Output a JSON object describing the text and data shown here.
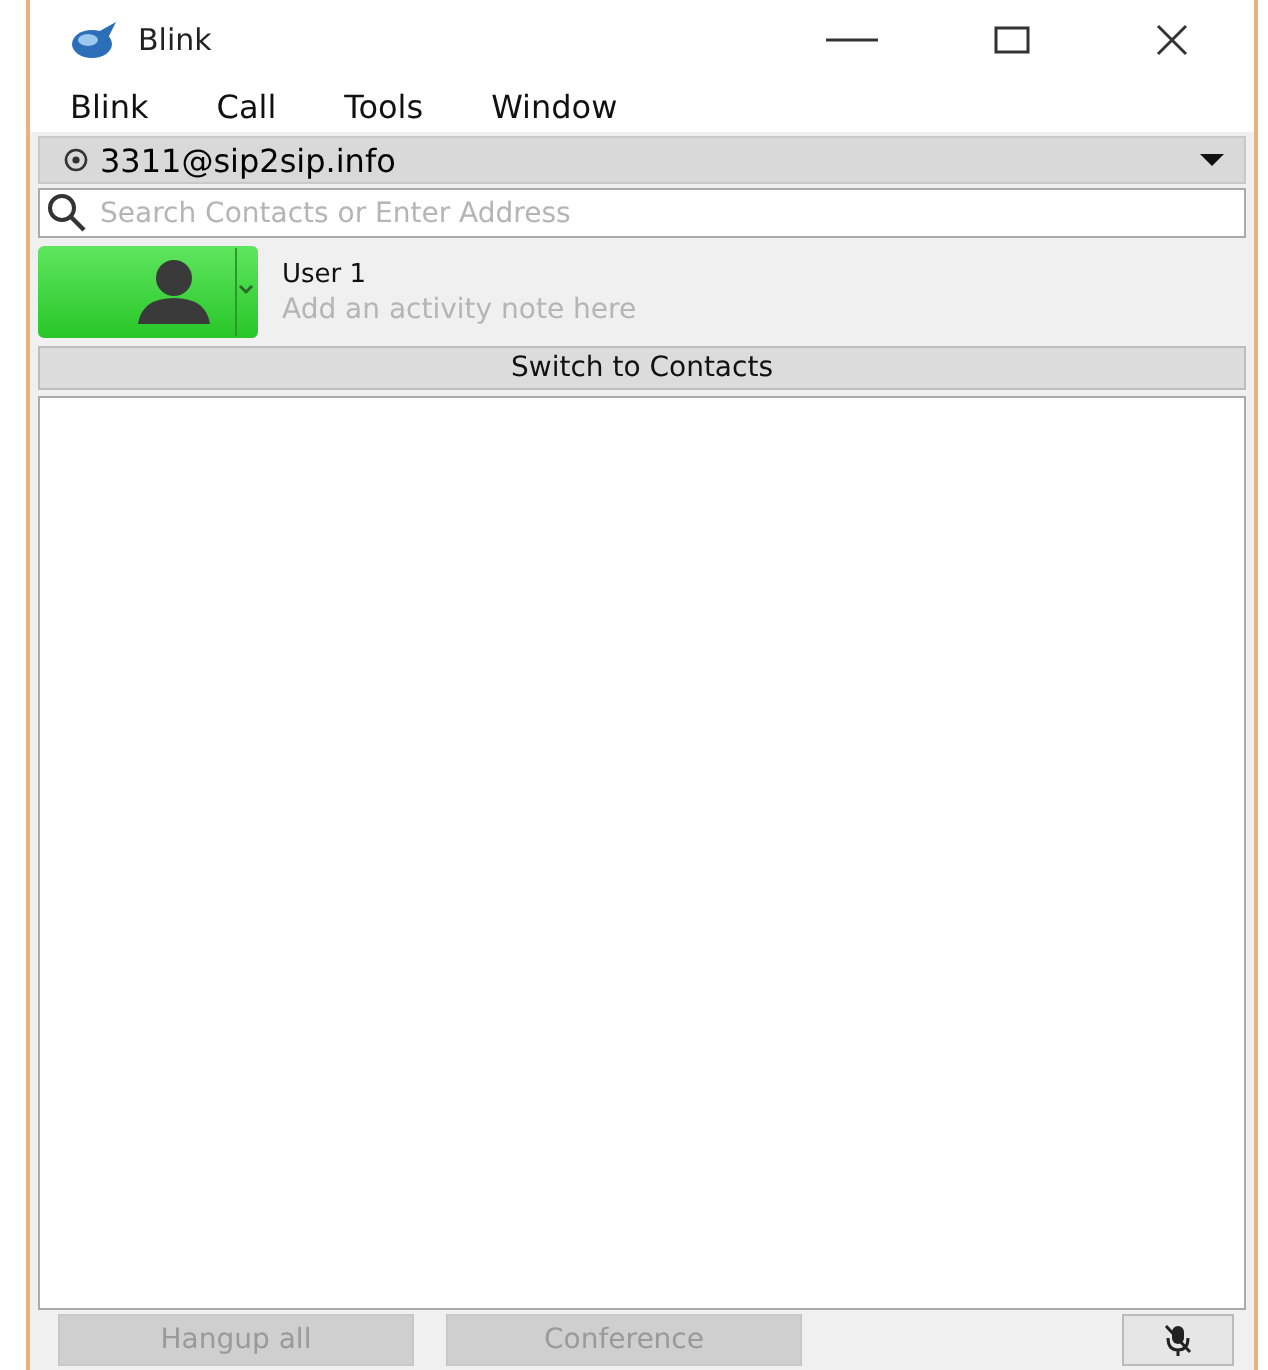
{
  "window": {
    "title": "Blink"
  },
  "menu": [
    "Blink",
    "Call",
    "Tools",
    "Window"
  ],
  "account": {
    "address": "3311@sip2sip.info"
  },
  "search": {
    "placeholder": "Search Contacts or Enter Address"
  },
  "user": {
    "name": "User 1",
    "placeholder": "Add an activity note here"
  },
  "switch_button": "Switch to Contacts",
  "buttons": [
    {
      "label": "Hangup all",
      "disabled": true
    },
    {
      "label": "Conference",
      "disabled": true
    }
  ]
}
